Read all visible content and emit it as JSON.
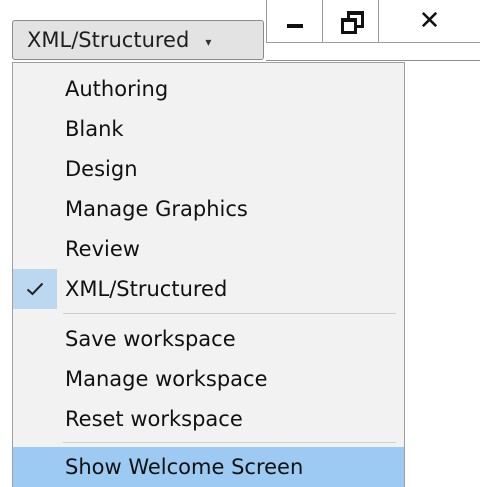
{
  "toolbar": {
    "workspace_label": "XML/Structured",
    "caret": "▾",
    "minimize": "minimize-icon",
    "restore": "restore-icon",
    "close": "close-icon"
  },
  "menu": {
    "workspaces": [
      {
        "label": "Authoring"
      },
      {
        "label": "Blank"
      },
      {
        "label": "Design"
      },
      {
        "label": "Manage Graphics"
      },
      {
        "label": "Review"
      },
      {
        "label": "XML/Structured"
      }
    ],
    "actions": [
      {
        "label": "Save workspace"
      },
      {
        "label": "Manage workspace"
      },
      {
        "label": "Reset workspace"
      }
    ],
    "extra": [
      {
        "label": "Show Welcome Screen"
      }
    ]
  },
  "colors": {
    "checked_bg": "#bcd8f1",
    "highlight_bg": "#9ccaf2",
    "menu_bg": "#f2f2f2"
  }
}
